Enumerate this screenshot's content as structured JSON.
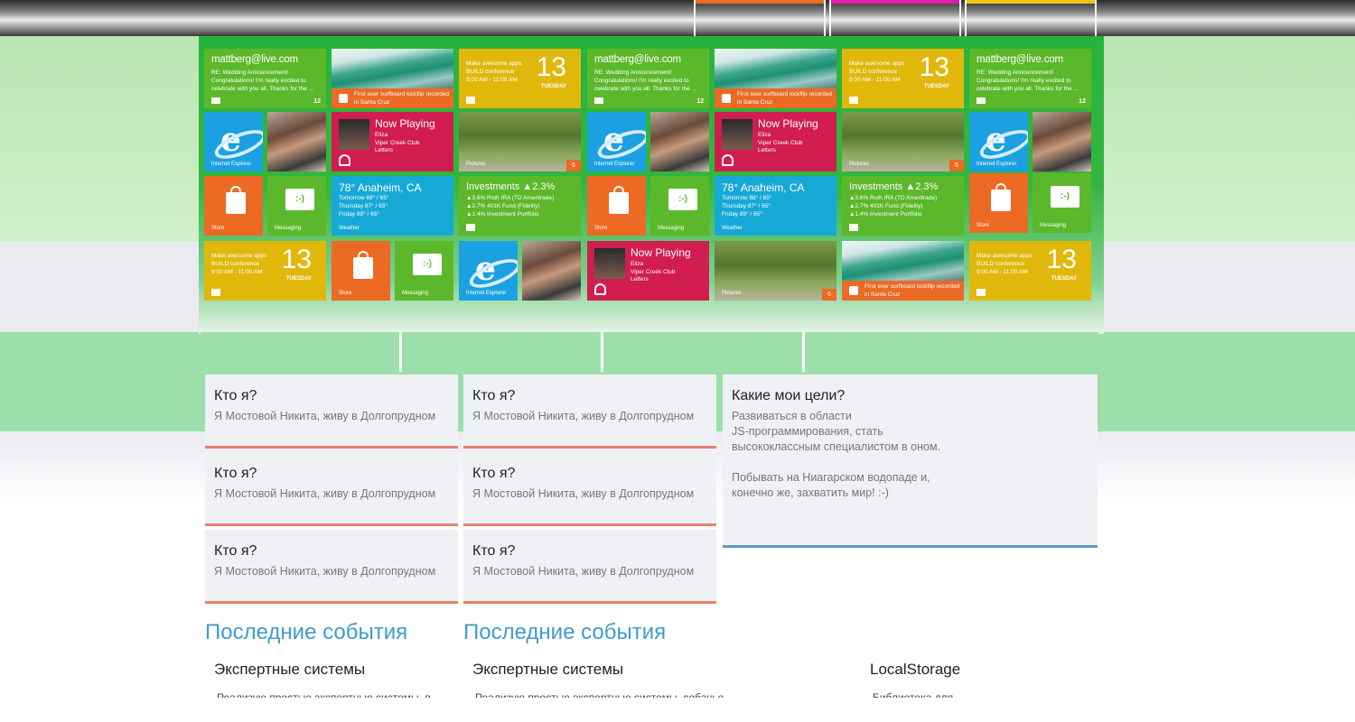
{
  "colors": {
    "accent_orange": "#ec6a24",
    "accent_magenta": "#e81aa8",
    "accent_yellow": "#f0c419",
    "section_blue": "#3f9bcf",
    "card_red": "#e8816b",
    "card_blue": "#5a9bc9"
  },
  "tiles": {
    "mail": {
      "address": "mattberg@live.com",
      "message": "RE: Wedding Announcement! Congratulations! I'm really excited to celebrate with you all. Thanks for the ...",
      "count": "12"
    },
    "surf": {
      "caption": "First ever surfboard kickflip recorded in Santa Cruz"
    },
    "calendar": {
      "event": "Make awesome apps\nBUILD conference\n9:00 AM - 11:00 AM",
      "day": "13",
      "weekday": "TUESDAY"
    },
    "ie": {
      "label": "Internet Explorer"
    },
    "now_playing": {
      "title": "Now Playing",
      "artist": "Eliza",
      "album": "Viper Creek Club",
      "track": "Letters"
    },
    "pictures": {
      "label": "Pictures",
      "count": "6"
    },
    "store": {
      "label": "Store"
    },
    "messaging": {
      "label": "Messaging",
      "emoticon": ":-)"
    },
    "weather": {
      "city": "78° Anaheim, CA",
      "rows": "Tomorrow  88° / 65°\nThursday  87° / 65°\nFriday  89° / 65°",
      "label": "Weather"
    },
    "investments": {
      "title": "Investments  ▲2.3%",
      "rows": "▲3.6%   Roth IRA (TD Ameritrade)\n▲2.7%   401K Fund (Fidelity)\n▲1.4%   Investment Portfolio"
    }
  },
  "cards": {
    "who_title": "Кто я?",
    "who_text": "Я Мостовой Никита, живу в Долгопрудном",
    "goals_title": "Какие мои цели?",
    "goals_text": "Развиваться в области\nJS-программирования, стать\nвысококлассным специалистом в оном.\n\nПобывать на Ниагарском водопаде и,\nконечно же, захватить мир! :-)"
  },
  "sections": {
    "events_title": "Последние события",
    "expert_title": "Экспертные системы",
    "localstorage_title": "LocalStorage",
    "expert_text": "Реализую простые экспертные системы, в",
    "expert_text2": "Реализую простые экспертные системы, собачье",
    "ls_text": "Библиотека для"
  }
}
